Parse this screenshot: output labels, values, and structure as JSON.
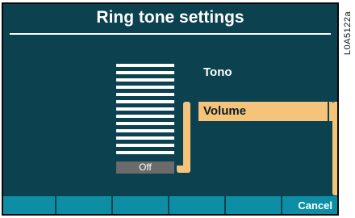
{
  "header": {
    "title": "Ring tone settings"
  },
  "volume_indicator": {
    "bars": 13,
    "current_label": "Off"
  },
  "menu": {
    "category_label": "Tono",
    "selected_item_label": "Volume"
  },
  "softkeys": {
    "labels": [
      "",
      "",
      "",
      "",
      "",
      "Cancel"
    ]
  },
  "figure_code": "L0A5122a",
  "colors": {
    "background": "#0c4150",
    "highlight": "#f5c37a",
    "softkey": "#0e8ea4",
    "text": "#ffffff"
  }
}
